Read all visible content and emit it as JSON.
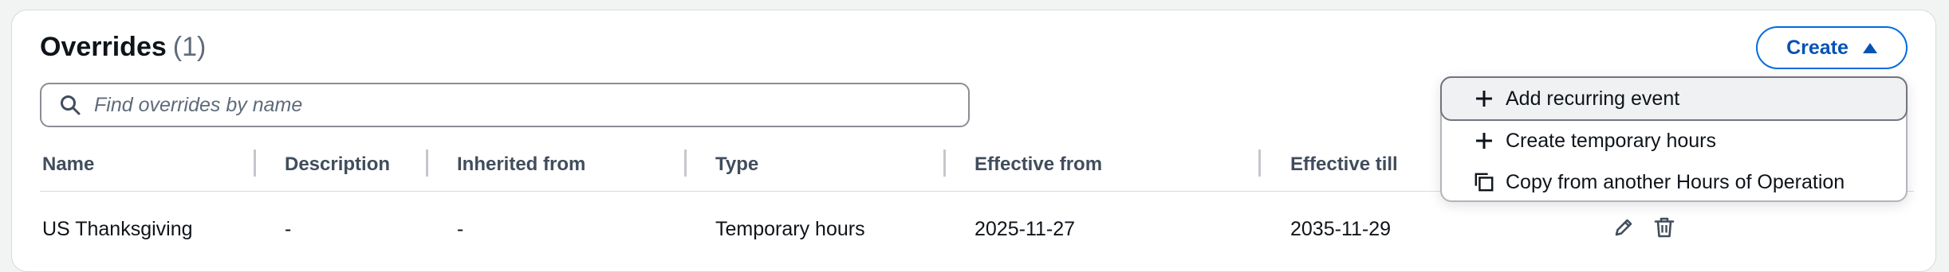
{
  "header": {
    "title": "Overrides",
    "count": "(1)"
  },
  "create_button": {
    "label": "Create",
    "icon": "caret-up-icon"
  },
  "search": {
    "placeholder": "Find overrides by name",
    "value": ""
  },
  "table": {
    "columns": [
      "Name",
      "Description",
      "Inherited from",
      "Type",
      "Effective from",
      "Effective till"
    ],
    "rows": [
      {
        "name": "US Thanksgiving",
        "description": "-",
        "inherited_from": "-",
        "type": "Temporary hours",
        "effective_from": "2025-11-27",
        "effective_till": "2035-11-29",
        "actions": [
          "edit-icon",
          "delete-icon"
        ]
      }
    ]
  },
  "create_menu": {
    "items": [
      {
        "label": "Add recurring event",
        "icon": "plus-icon"
      },
      {
        "label": "Create temporary hours",
        "icon": "plus-icon"
      },
      {
        "label": "Copy from another Hours of Operation",
        "icon": "copy-icon"
      }
    ]
  },
  "colors": {
    "primary": "#006ce0",
    "primary_text": "#0552b5",
    "border": "#8c8c94",
    "heading": "#0f141a",
    "muted": "#5f6b7a"
  }
}
